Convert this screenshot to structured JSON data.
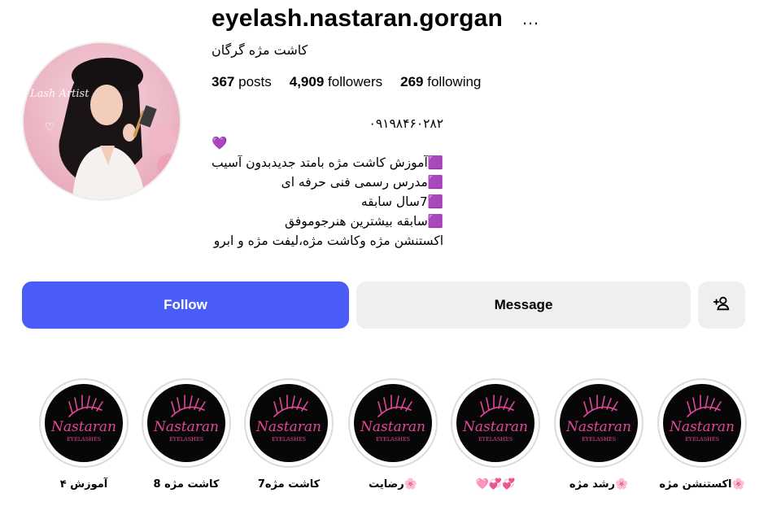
{
  "profile": {
    "username": "eyelash.nastaran.gorgan",
    "more_icon": "…",
    "full_name": "کاشت مژه گرگان",
    "avatar_text": "Lash Artist"
  },
  "stats": {
    "posts_count": "367",
    "posts_label": "posts",
    "followers_count": "4,909",
    "followers_label": "followers",
    "following_count": "269",
    "following_label": "following"
  },
  "bio": {
    "lines": [
      "۰۹۱۹۸۴۶۰۲۸۲",
      "💜",
      "🟪آموزش کاشت مژه بامتد جدیدبدون آسیب",
      "🟪مدرس رسمی فنی حرفه ای",
      "🟪7سال سابقه",
      "🟪سابقه بیشترین هنرجوموفق",
      "اکستنشن مژه وکاشت مژه،لیفت مژه و ابرو"
    ]
  },
  "actions": {
    "follow_label": "Follow",
    "message_label": "Message",
    "add_user_icon": "add-user-icon"
  },
  "highlight_cover": {
    "title": "Nastaran",
    "subtitle": "EYELASHES"
  },
  "highlights": [
    {
      "label": "آموزش ۴"
    },
    {
      "label": "کاشت مژه 8"
    },
    {
      "label": "کاشت مژه7"
    },
    {
      "label": "🌸رضایت"
    },
    {
      "label": "💞💞🩷"
    },
    {
      "label": "🌸رشد مژه"
    },
    {
      "label": "🌸اکستنشن مژه"
    }
  ],
  "colors": {
    "follow_button": "#4a5df9",
    "secondary_button": "#efefef",
    "highlight_bg": "#070707",
    "highlight_pink": "#e0489a"
  }
}
